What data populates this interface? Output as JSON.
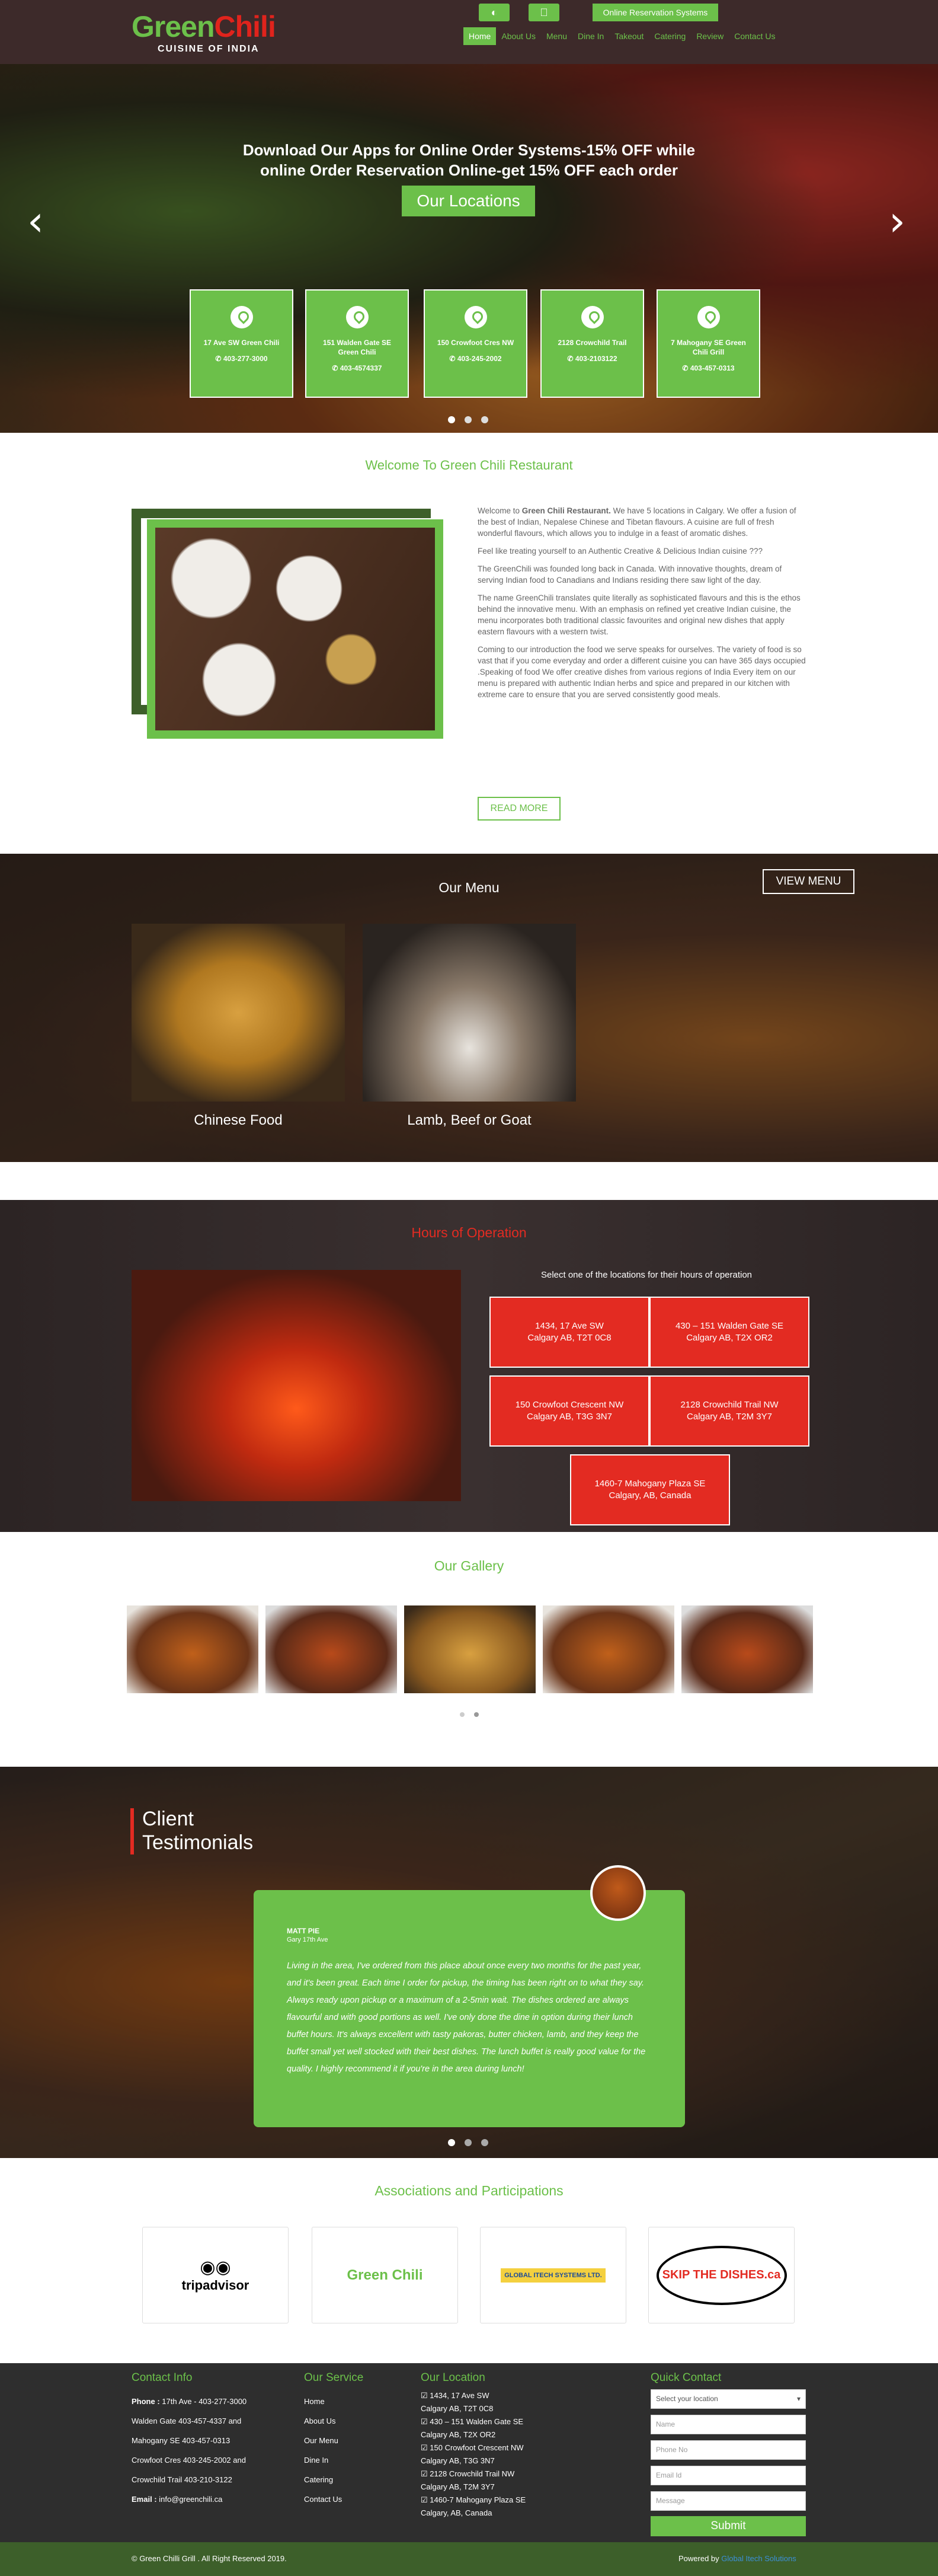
{
  "header": {
    "logo_word_1": "Green",
    "logo_word_2": "Chili",
    "logo_tagline": "CUISINE OF INDIA",
    "android_icon": "android-icon",
    "apple_icon": "apple-icon",
    "reservation_label": "Online Reservation Systems",
    "nav": [
      "Home",
      "About Us",
      "Menu",
      "Dine In",
      "Takeout",
      "Catering",
      "Review",
      "Contact Us"
    ],
    "active_nav": "Home"
  },
  "hero": {
    "headline_1": "Download Our Apps for Online Order Systems-15% OFF while",
    "headline_2": "online Order Reservation Online-get 15% OFF each order",
    "locations_btn": "Our Locations",
    "locations": [
      {
        "address": "17 Ave SW Green Chili",
        "phone": "403-277-3000"
      },
      {
        "address": "151 Walden Gate SE Green Chili",
        "phone": "403-4574337"
      },
      {
        "address": "150 Crowfoot Cres NW",
        "phone": "403-245-2002"
      },
      {
        "address": "2128 Crowchild Trail",
        "phone": "403-2103122"
      },
      {
        "address": "7 Mahogany SE Green Chili Grill",
        "phone": "403-457-0313"
      }
    ]
  },
  "welcome": {
    "title": "Welcome To Green Chili Restaurant",
    "p1_a": "Welcome to ",
    "p1_b": "Green Chili Restaurant.",
    "p1_c": " We have 5 locations in Calgary. We offer a fusion of the best of Indian, Nepalese Chinese and Tibetan flavours. A cuisine are full of fresh wonderful flavours, which allows you to indulge in a feast of aromatic dishes.",
    "p2": "Feel like treating yourself to an Authentic Creative & Delicious Indian cuisine ???",
    "p3": "The GreenChili was founded long back in Canada. With innovative thoughts, dream of serving Indian food to Canadians and Indians residing there saw light of the day.",
    "p4": " The name GreenChili translates quite literally as sophisticated flavours and this is the ethos behind the innovative menu. With an emphasis on refined yet creative Indian cuisine, the menu incorporates both traditional classic favourites and original new dishes that apply eastern flavours with a western twist.",
    "p5": "Coming to our introduction the food we serve speaks for ourselves. The variety of food is so vast that if you come everyday and order a different cuisine you can have 365 days occupied .Speaking of food We offer creative dishes from various regions of India Every item on our menu is prepared with authentic Indian herbs and spice and prepared in our kitchen with extreme care to ensure that you are served consistently good meals.",
    "read_more": "READ MORE"
  },
  "menu": {
    "view_menu": "VIEW MENU",
    "title": "Our Menu",
    "items": [
      "Chinese Food",
      "Lamb, Beef or Goat"
    ]
  },
  "hours": {
    "title": "Hours of Operation",
    "prompt": "Select one of the locations for their hours of operation",
    "locations": [
      {
        "line1": "1434, 17 Ave SW",
        "line2": "Calgary AB, T2T 0C8"
      },
      {
        "line1": "430 – 151 Walden Gate SE",
        "line2": "Calgary AB, T2X OR2"
      },
      {
        "line1": "150 Crowfoot Crescent NW",
        "line2": "Calgary AB, T3G 3N7"
      },
      {
        "line1": "2128 Crowchild Trail NW",
        "line2": "Calgary AB, T2M 3Y7"
      },
      {
        "line1": "1460-7 Mahogany Plaza SE",
        "line2": "Calgary, AB, Canada"
      }
    ]
  },
  "gallery": {
    "title": "Our Gallery"
  },
  "testimonials": {
    "title_1": "Client",
    "title_2": "Testimonials",
    "name": "MATT PIE",
    "location": "Gary 17th Ave",
    "quote": "Living in the area, I've ordered from this place about once every two months for the past year, and it's been great. Each time I order for pickup, the timing has been right on to what they say. Always ready upon pickup or a maximum of a 2-5min wait. The dishes ordered are always flavourful and with good portions as well. I've only done the dine in option during their lunch buffet hours. It's always excellent with tasty pakoras, butter chicken, lamb, and they keep the buffet small yet well stocked with their best dishes. The lunch buffet is really good value for the quality. I highly recommend it if you're in the area during lunch!"
  },
  "associations": {
    "title": "Associations and Participations",
    "logos": [
      "tripadvisor",
      "Green Chili",
      "GLOBAL ITECH SYSTEMS LTD.",
      "SKIP THE DISHES.ca"
    ]
  },
  "footer": {
    "contact_head": "Contact Info",
    "phone_label": "Phone :",
    "contact_lines": [
      " 17th Ave - 403-277-3000",
      "Walden Gate 403-457-4337 and",
      "Mahogany SE 403-457-0313",
      "Crowfoot Cres 403-245-2002 and",
      "Crowchild Trail 403-210-3122"
    ],
    "email_label": "Email :",
    "email": " info@greenchili.ca",
    "service_head": "Our Service",
    "services": [
      "Home",
      "About Us",
      "Our Menu",
      "Dine In",
      "Catering",
      "Contact Us"
    ],
    "location_head": "Our Location",
    "location_lines": [
      "1434, 17 Ave SW",
      "Calgary AB, T2T 0C8",
      "430 – 151 Walden Gate SE",
      "Calgary AB, T2X OR2",
      "150 Crowfoot Crescent NW",
      "Calgary AB, T3G 3N7",
      "2128 Crowchild Trail NW",
      "Calgary AB, T2M 3Y7",
      "1460-7 Mahogany Plaza SE",
      "Calgary, AB, Canada"
    ],
    "quick_head": "Quick Contact",
    "select_placeholder": "Select your location",
    "name_placeholder": "Name",
    "phone_placeholder": "Phone No",
    "email_placeholder": "Email Id",
    "message_placeholder": "Message",
    "submit": "Submit",
    "copyright": "© Green Chilli Grill . All Right Reserved 2019.",
    "powered_by": "Powered by ",
    "powered_link": "Global Itech Solutions"
  }
}
